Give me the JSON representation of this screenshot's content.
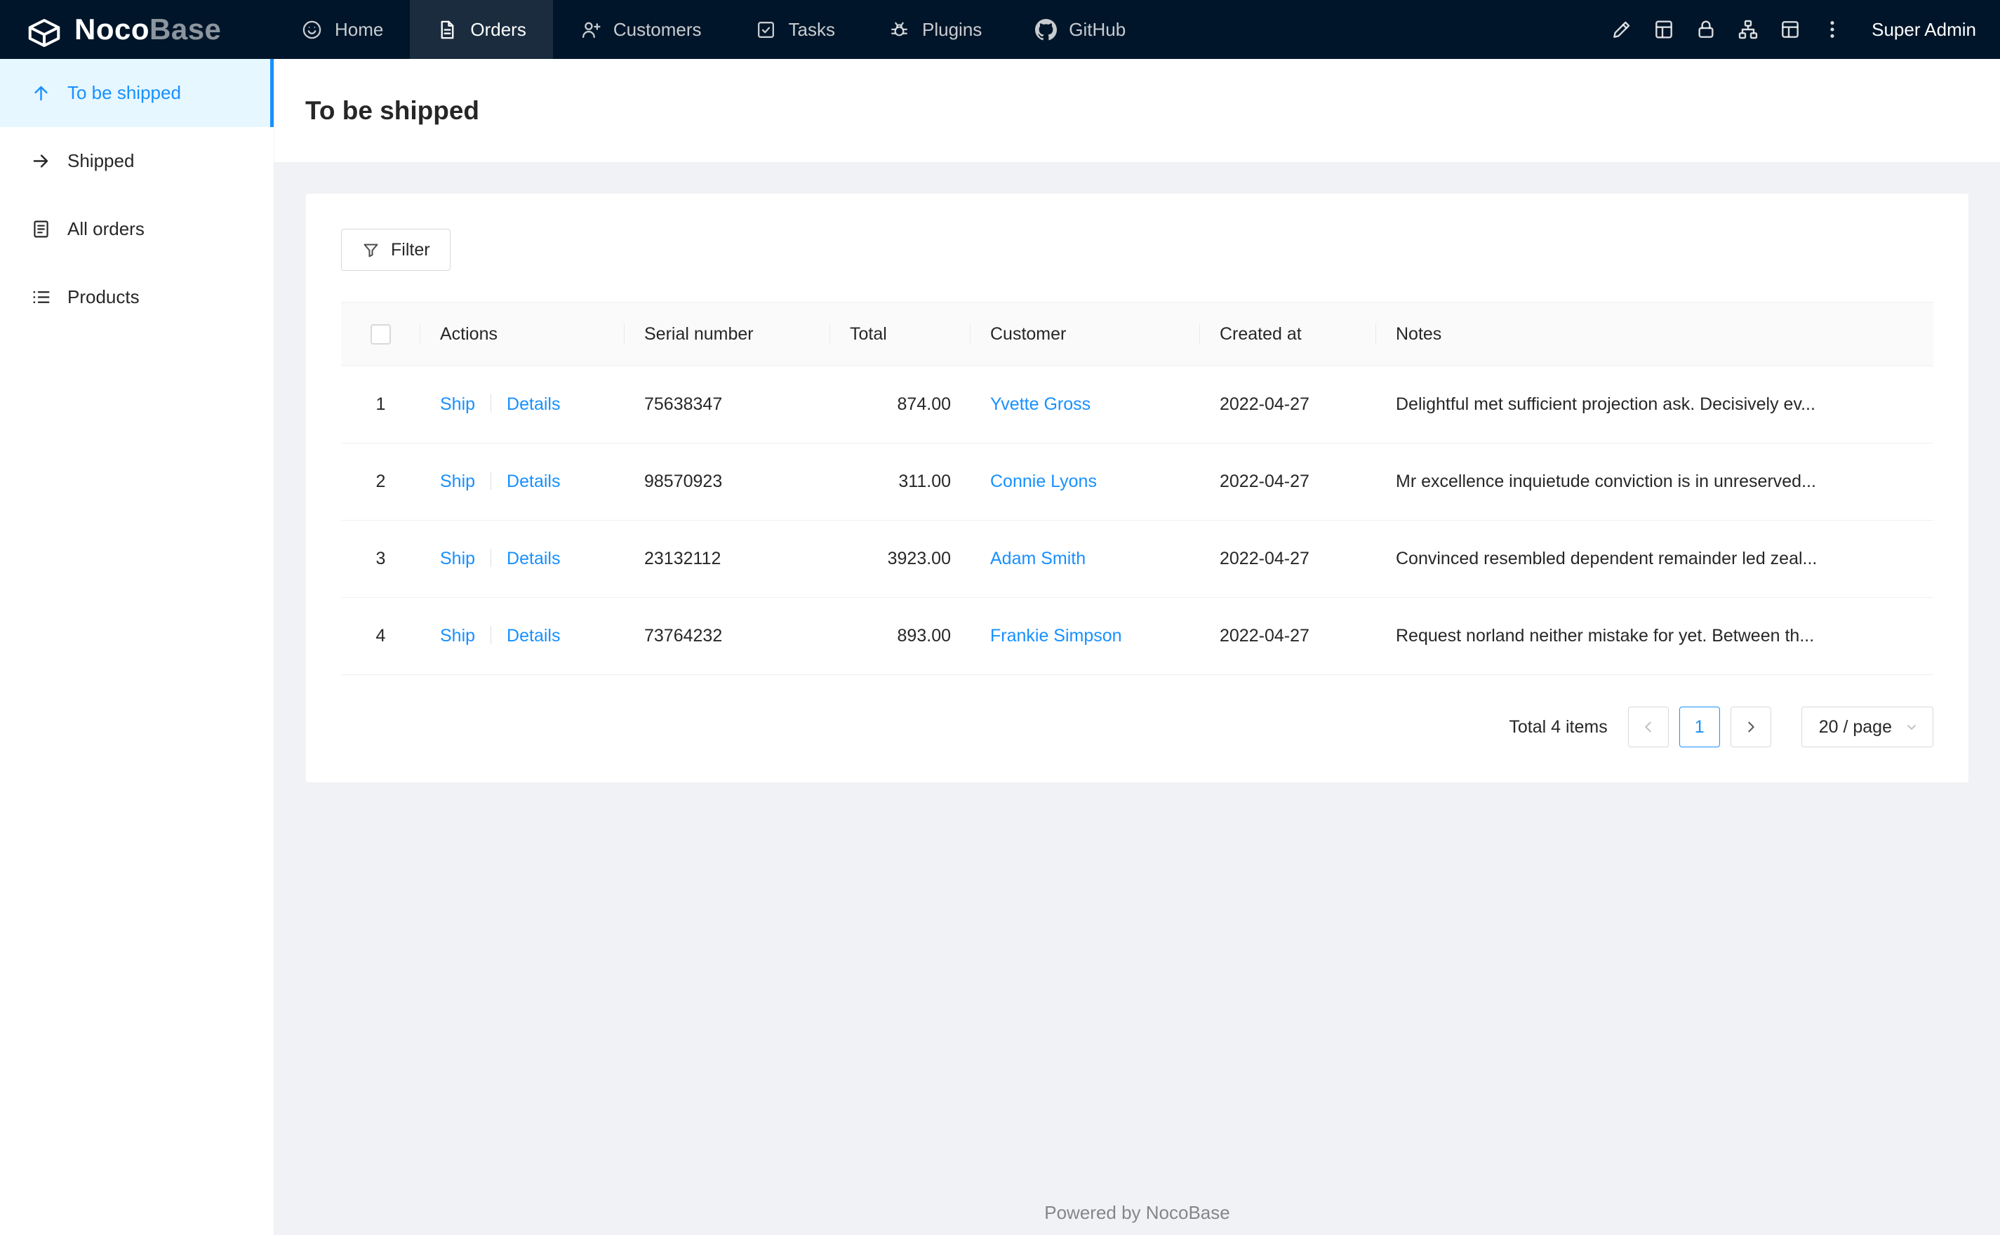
{
  "navbar": {
    "logo_primary": "Noco",
    "logo_secondary": "Base",
    "items": [
      {
        "label": "Home"
      },
      {
        "label": "Orders"
      },
      {
        "label": "Customers"
      },
      {
        "label": "Tasks"
      },
      {
        "label": "Plugins"
      },
      {
        "label": "GitHub"
      }
    ],
    "user": "Super Admin"
  },
  "sidebar": {
    "items": [
      {
        "label": "To be shipped"
      },
      {
        "label": "Shipped"
      },
      {
        "label": "All orders"
      },
      {
        "label": "Products"
      }
    ]
  },
  "page": {
    "title": "To be shipped"
  },
  "toolbar": {
    "filter": "Filter"
  },
  "table": {
    "columns": {
      "actions": "Actions",
      "serial": "Serial number",
      "total": "Total",
      "customer": "Customer",
      "created": "Created at",
      "notes": "Notes"
    },
    "rows": [
      {
        "index": "1",
        "action_ship": "Ship",
        "action_details": "Details",
        "serial": "75638347",
        "total": "874.00",
        "customer": "Yvette Gross",
        "created": "2022-04-27",
        "notes": "Delightful met sufficient projection ask. Decisively ev..."
      },
      {
        "index": "2",
        "action_ship": "Ship",
        "action_details": "Details",
        "serial": "98570923",
        "total": "311.00",
        "customer": "Connie Lyons",
        "created": "2022-04-27",
        "notes": "Mr excellence inquietude conviction is in unreserved..."
      },
      {
        "index": "3",
        "action_ship": "Ship",
        "action_details": "Details",
        "serial": "23132112",
        "total": "3923.00",
        "customer": "Adam Smith",
        "created": "2022-04-27",
        "notes": "Convinced resembled dependent remainder led zeal..."
      },
      {
        "index": "4",
        "action_ship": "Ship",
        "action_details": "Details",
        "serial": "73764232",
        "total": "893.00",
        "customer": "Frankie Simpson",
        "created": "2022-04-27",
        "notes": "Request norland neither mistake for yet. Between th..."
      }
    ]
  },
  "pagination": {
    "total_text": "Total 4 items",
    "current_page": "1",
    "page_size": "20 / page"
  },
  "footer": {
    "text": "Powered by NocoBase"
  },
  "colors": {
    "primary": "#1890ff",
    "navbar_bg": "#001529",
    "sidebar_active_bg": "#e6f7ff",
    "content_bg": "#f0f2f5"
  }
}
